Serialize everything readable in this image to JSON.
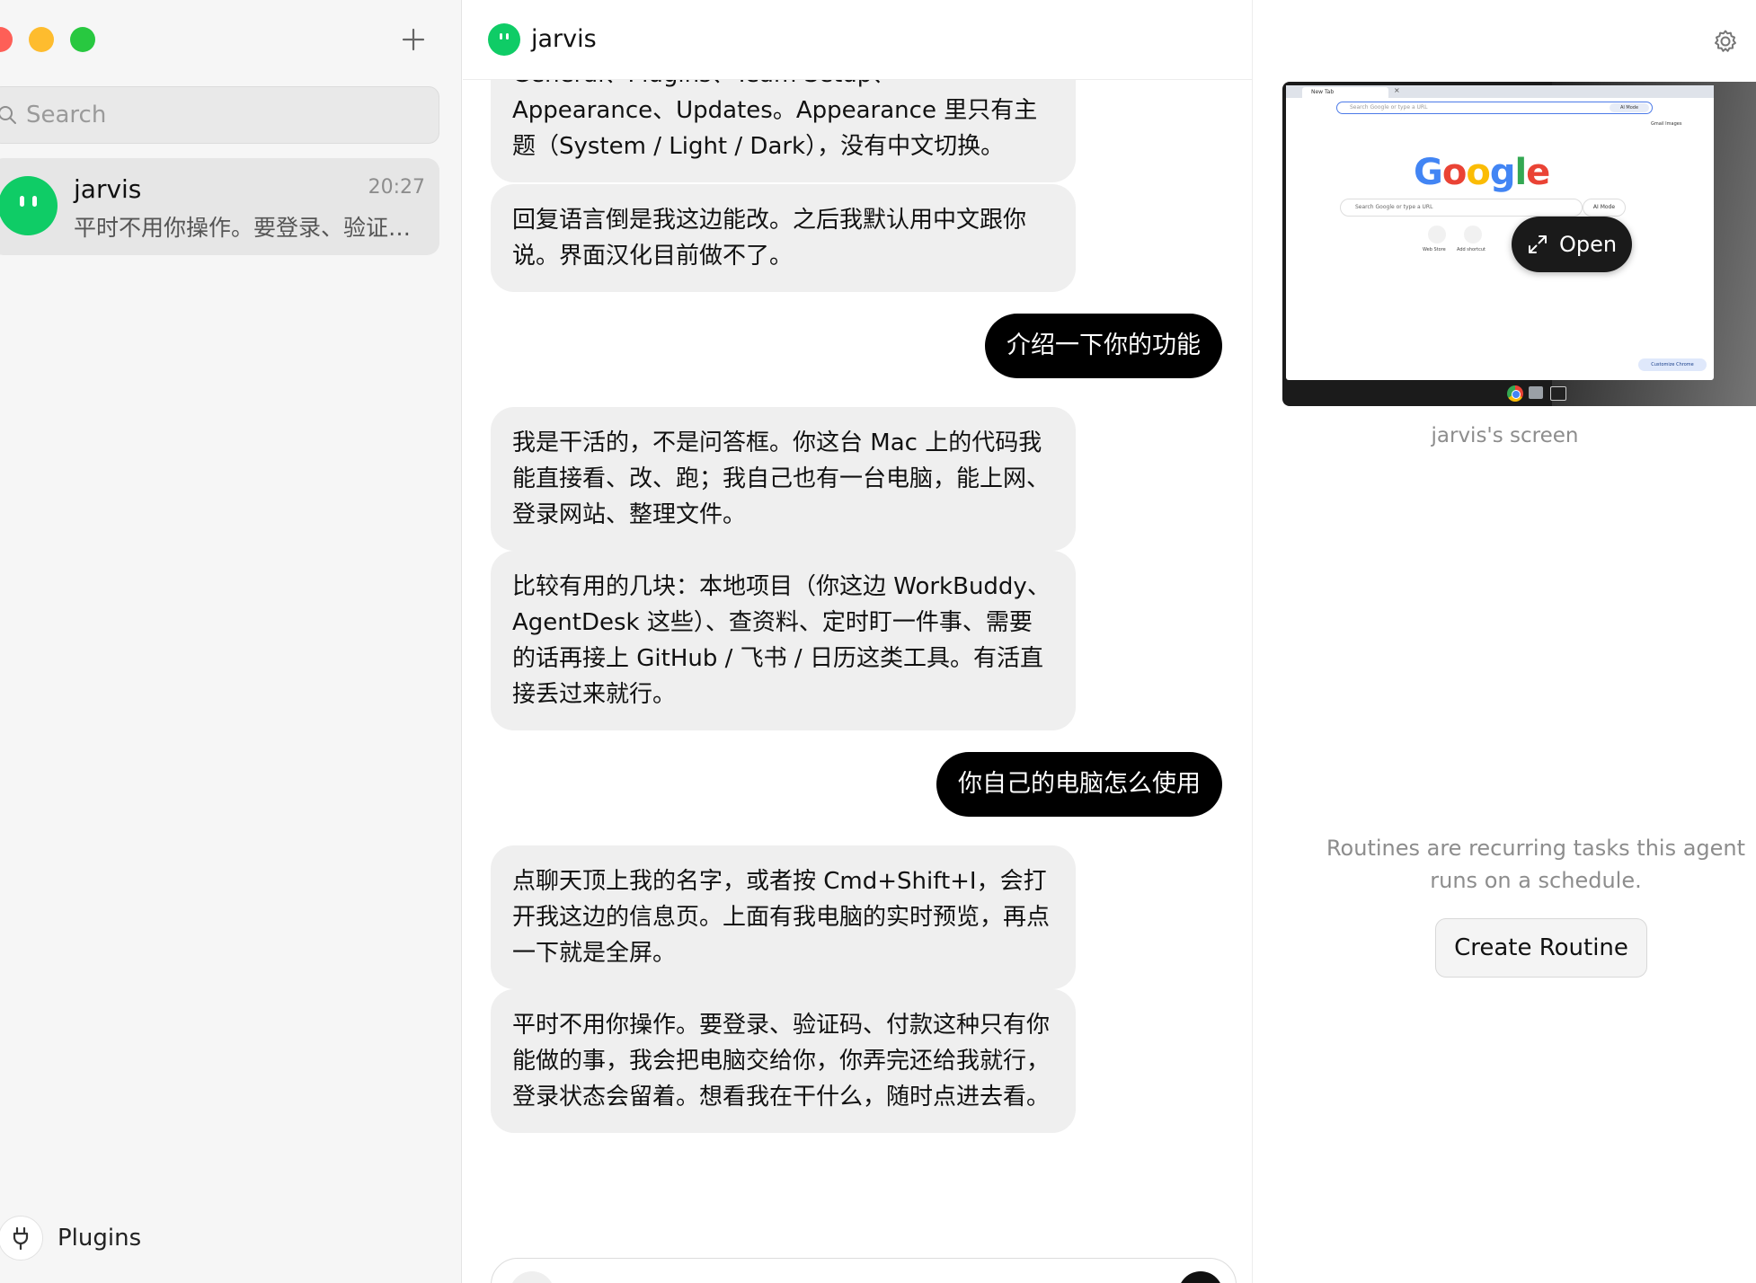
{
  "sidebar": {
    "search_placeholder": "Search",
    "chats": [
      {
        "name": "jarvis",
        "time": "20:27",
        "preview": "平时不用你操作。要登录、验证码、付款这种只有你能做的事"
      }
    ],
    "plugins_label": "Plugins"
  },
  "header": {
    "title": "jarvis"
  },
  "messages": [
    {
      "role": "agent",
      "text": "General、Plugins、Team Setup、Appearance、Updates。Appearance 里只有主题（System / Light / Dark），没有中文切换。"
    },
    {
      "role": "agent",
      "text": "回复语言倒是我这边能改。之后我默认用中文跟你说。界面汉化目前做不了。"
    },
    {
      "role": "user",
      "text": "介绍一下你的功能"
    },
    {
      "role": "agent",
      "text": "我是干活的，不是问答框。你这台 Mac 上的代码我能直接看、改、跑；我自己也有一台电脑，能上网、登录网站、整理文件。"
    },
    {
      "role": "agent",
      "text": "比较有用的几块：本地项目（你这边 WorkBuddy、AgentDesk 这些）、查资料、定时盯一件事、需要的话再接上 GitHub / 飞书 / 日历这类工具。有活直接丢过来就行。"
    },
    {
      "role": "user",
      "text": "你自己的电脑怎么使用"
    },
    {
      "role": "agent",
      "text": "点聊天顶上我的名字，或者按 Cmd+Shift+I，会打开我这边的信息页。上面有我电脑的实时预览，再点一下就是全屏。"
    },
    {
      "role": "agent",
      "text": "平时不用你操作。要登录、验证码、付款这种只有你能做的事，我会把电脑交给你，你弄完还给我就行，登录状态会留着。想看我在干什么，随时点进去看。"
    }
  ],
  "right_panel": {
    "screen_preview": {
      "tab_title": "New Tab",
      "url_placeholder": "Search Google or type a URL",
      "ai_mode_label": "AI Mode",
      "top_links": "Gmail   Images",
      "logo_letters": [
        "G",
        "o",
        "o",
        "g",
        "l",
        "e"
      ],
      "logo_colors": [
        "#4285f4",
        "#ea4335",
        "#fbbc05",
        "#4285f4",
        "#34a853",
        "#ea4335"
      ],
      "search_placeholder": "Search Google or type a URL",
      "search_ai_label": "AI Mode",
      "shortcut_1": "Web Store",
      "shortcut_2": "Add shortcut",
      "customize_label": "Customize Chrome",
      "open_label": "Open"
    },
    "screen_caption": "jarvis's screen",
    "routines_text": "Routines are recurring tasks this agent runs on a schedule.",
    "create_routine_label": "Create Routine"
  },
  "colors": {
    "accent_green": "#0fcc66",
    "user_bubble": "#000000",
    "agent_bubble": "#efefef"
  },
  "icons": {
    "new_chat": "plus-icon",
    "search": "search-icon",
    "plugins": "plug-icon",
    "settings": "gear-icon",
    "open": "expand-icon"
  }
}
